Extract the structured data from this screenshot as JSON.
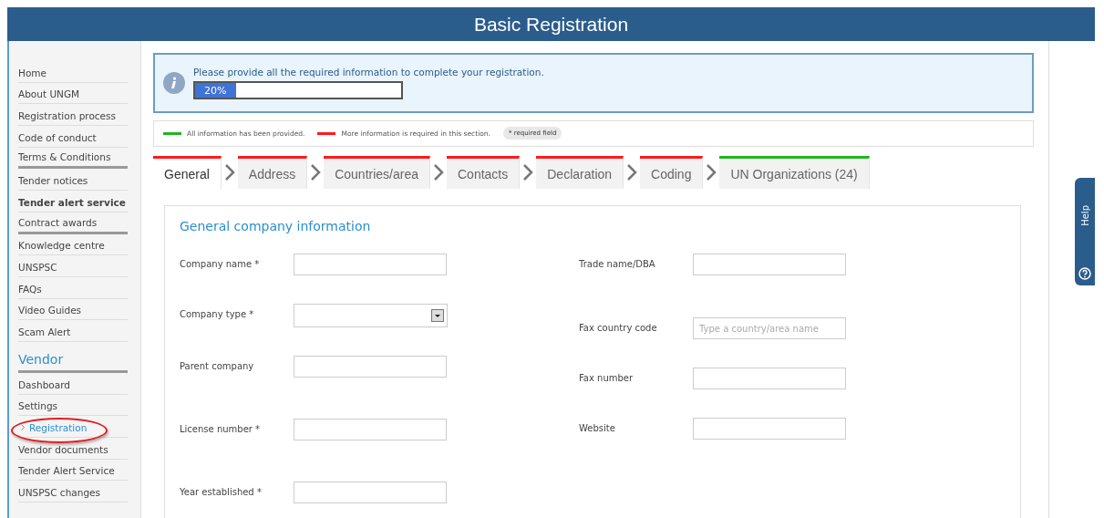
{
  "header": {
    "title": "Basic Registration"
  },
  "sidebar": {
    "items": [
      {
        "label": "Home",
        "kind": "link",
        "selected": false,
        "bold": false,
        "group_end": false,
        "circled": false
      },
      {
        "label": "About UNGM",
        "kind": "link",
        "selected": false,
        "bold": false,
        "group_end": false,
        "circled": false
      },
      {
        "label": "Registration process",
        "kind": "link",
        "selected": false,
        "bold": false,
        "group_end": false,
        "circled": false
      },
      {
        "label": "Code of conduct",
        "kind": "link",
        "selected": false,
        "bold": false,
        "group_end": false,
        "circled": false
      },
      {
        "label": "Terms & Conditions",
        "kind": "link",
        "selected": false,
        "bold": false,
        "group_end": true,
        "circled": false
      },
      {
        "label": "Tender notices",
        "kind": "link",
        "selected": false,
        "bold": false,
        "group_end": false,
        "circled": false
      },
      {
        "label": "Tender alert service",
        "kind": "link",
        "selected": false,
        "bold": true,
        "group_end": false,
        "circled": false
      },
      {
        "label": "Contract awards",
        "kind": "link",
        "selected": false,
        "bold": false,
        "group_end": true,
        "circled": false
      },
      {
        "label": "Knowledge centre",
        "kind": "link",
        "selected": false,
        "bold": false,
        "group_end": false,
        "circled": false
      },
      {
        "label": "UNSPSC",
        "kind": "link",
        "selected": false,
        "bold": false,
        "group_end": false,
        "circled": false
      },
      {
        "label": "FAQs",
        "kind": "link",
        "selected": false,
        "bold": false,
        "group_end": false,
        "circled": false
      },
      {
        "label": "Video Guides",
        "kind": "link",
        "selected": false,
        "bold": false,
        "group_end": false,
        "circled": false
      },
      {
        "label": "Scam Alert",
        "kind": "link",
        "selected": false,
        "bold": false,
        "group_end": false,
        "circled": false
      },
      {
        "label": "Vendor",
        "kind": "heading",
        "selected": false,
        "bold": false,
        "group_end": true,
        "circled": false
      },
      {
        "label": "Dashboard",
        "kind": "link",
        "selected": false,
        "bold": false,
        "group_end": false,
        "circled": false
      },
      {
        "label": "Settings",
        "kind": "link",
        "selected": false,
        "bold": false,
        "group_end": false,
        "circled": false
      },
      {
        "label": "Registration",
        "kind": "link",
        "selected": true,
        "bold": false,
        "group_end": false,
        "circled": true
      },
      {
        "label": "Vendor documents",
        "kind": "link",
        "selected": false,
        "bold": false,
        "group_end": false,
        "circled": false
      },
      {
        "label": "Tender Alert Service",
        "kind": "link",
        "selected": false,
        "bold": false,
        "group_end": false,
        "circled": false
      },
      {
        "label": "UNSPSC changes",
        "kind": "link",
        "selected": false,
        "bold": false,
        "group_end": false,
        "circled": false
      }
    ]
  },
  "info": {
    "message": "Please provide all the required information to complete your registration.",
    "progress_label": "20%",
    "level": 0.2
  },
  "legend": {
    "items": [
      {
        "label": "All information has been provided.",
        "color": "#22b422"
      },
      {
        "label": "More information is required in this section.",
        "color": "#ff1a1a"
      }
    ],
    "required_note": "* required field"
  },
  "tabs": [
    {
      "label": "General",
      "selected": true,
      "color": "#ff1a1a"
    },
    {
      "label": "Address",
      "selected": false,
      "color": "#ff1a1a"
    },
    {
      "label": "Countries/area",
      "selected": false,
      "color": "#ff1a1a"
    },
    {
      "label": "Contacts",
      "selected": false,
      "color": "#ff1a1a"
    },
    {
      "label": "Declaration",
      "selected": false,
      "color": "#ff1a1a"
    },
    {
      "label": "Coding",
      "selected": false,
      "color": "#ff1a1a"
    },
    {
      "label": "UN Organizations (24)",
      "selected": false,
      "color": "#22b422"
    }
  ],
  "form": {
    "title": "General company information",
    "left_fields": [
      {
        "label": "Company name *",
        "kind": "text"
      },
      {
        "label": "Company type *",
        "kind": "select"
      },
      {
        "label": "Parent company",
        "kind": "text"
      },
      {
        "label": "License number *",
        "kind": "text"
      },
      {
        "label": "Year established *",
        "kind": "text"
      }
    ],
    "right_fields": [
      {
        "label": "Trade name/DBA",
        "kind": "text"
      },
      {
        "label": "Fax country code",
        "kind": "text",
        "placeholder": "Type a country/area name"
      },
      {
        "label": "Fax number",
        "kind": "text"
      },
      {
        "label": "Website",
        "kind": "text"
      }
    ]
  },
  "help_tab": {
    "label": "Help"
  }
}
